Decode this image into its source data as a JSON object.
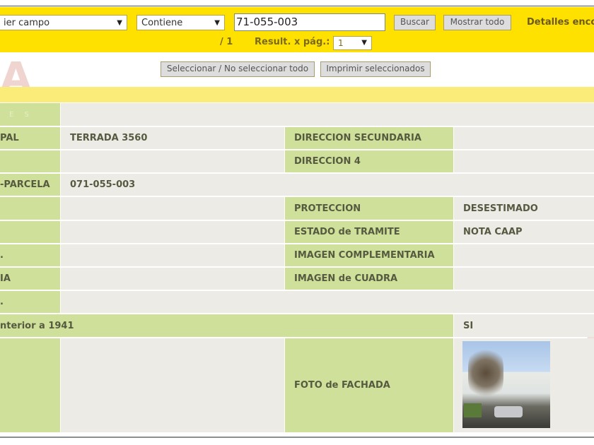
{
  "search": {
    "field_select": "ier campo",
    "operator_select": "Contiene",
    "query": "71-055-003",
    "buscar": "Buscar",
    "mostrar_todo": "Mostrar todo",
    "detalles": "Detalles enco"
  },
  "paging": {
    "pages": "/ 1",
    "results_label": "Result. x pág.:",
    "results_value": "1"
  },
  "actions": {
    "select_all": "Seleccionar / No seleccionar todo",
    "print": "Imprimir seleccionados"
  },
  "logo": {
    "text": "A",
    "subtext": "E S"
  },
  "record": {
    "dir_principal_label": "PAL",
    "dir_principal": "TERRADA 3560",
    "dir_secundaria_label": "DIRECCION SECUNDARIA",
    "dir_secundaria": "",
    "dir4_label": "DIRECCION 4",
    "dir4": "",
    "parcela_label": "-PARCELA",
    "parcela": "071-055-003",
    "proteccion_label": "PROTECCION",
    "proteccion": "DESESTIMADO",
    "estado_label": "ESTADO de TRAMITE",
    "estado": "NOTA CAAP",
    "img_comp_label": "IMAGEN COMPLEMENTARIA",
    "row7_label": ".",
    "cuadra_label": "IMAGEN de CUADRA",
    "row8_label": "IA",
    "row9_label": ".",
    "anterior_label": "nterior a 1941",
    "anterior": "SI",
    "foto_label": "FOTO de FACHADA"
  }
}
